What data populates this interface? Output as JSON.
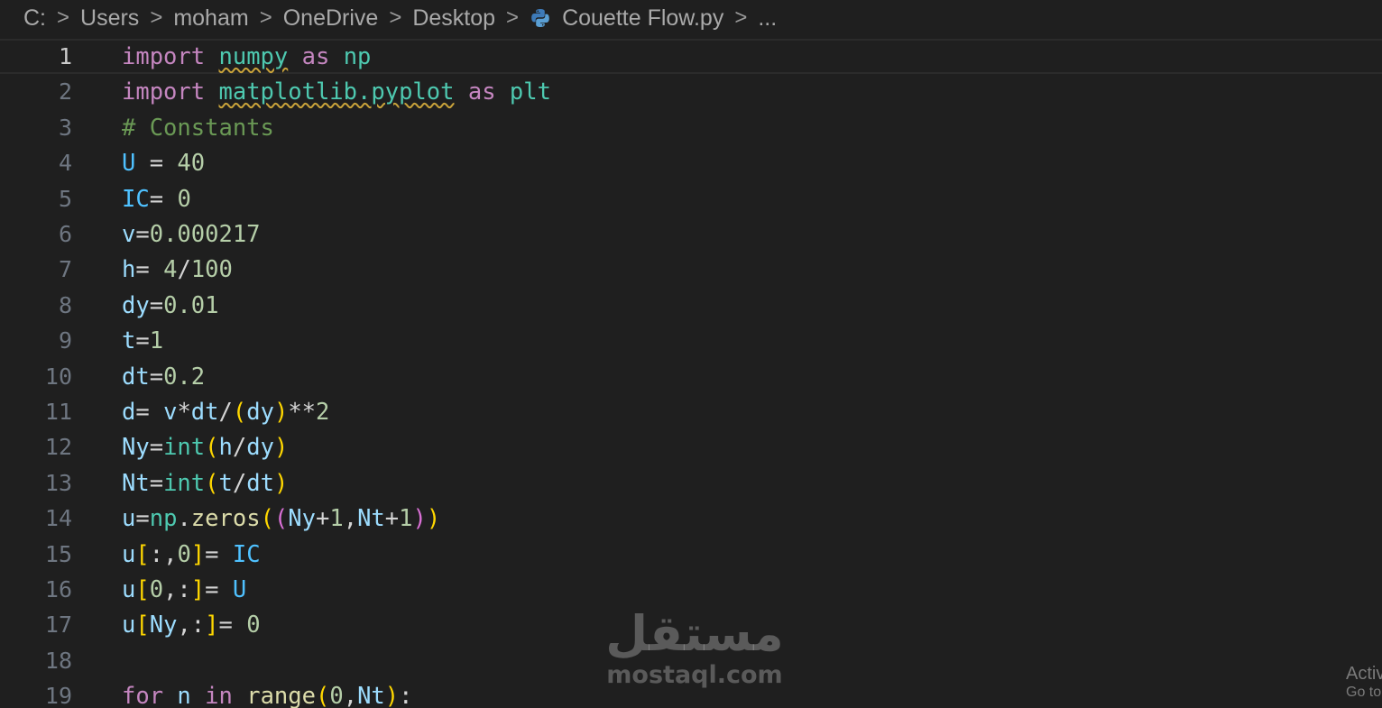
{
  "breadcrumb": {
    "items": [
      "C:",
      "Users",
      "moham",
      "OneDrive",
      "Desktop",
      "Couette Flow.py",
      "..."
    ],
    "separator": ">"
  },
  "editor": {
    "current_line": 1,
    "lines": [
      {
        "n": "1",
        "tokens": [
          [
            "import",
            "kw"
          ],
          [
            " ",
            "op"
          ],
          [
            "numpy",
            "mod squig"
          ],
          [
            " ",
            "op"
          ],
          [
            "as",
            "kw"
          ],
          [
            " ",
            "op"
          ],
          [
            "np",
            "mod"
          ]
        ]
      },
      {
        "n": "2",
        "tokens": [
          [
            "import",
            "kw"
          ],
          [
            " ",
            "op"
          ],
          [
            "matplotlib.pyplot",
            "mod squig"
          ],
          [
            " ",
            "op"
          ],
          [
            "as",
            "kw"
          ],
          [
            " ",
            "op"
          ],
          [
            "plt",
            "mod"
          ]
        ]
      },
      {
        "n": "3",
        "tokens": [
          [
            "# Constants",
            "cmt"
          ]
        ]
      },
      {
        "n": "4",
        "tokens": [
          [
            "U",
            "cst"
          ],
          [
            " = ",
            "op"
          ],
          [
            "40",
            "num"
          ]
        ]
      },
      {
        "n": "5",
        "tokens": [
          [
            "IC",
            "cst"
          ],
          [
            "= ",
            "op"
          ],
          [
            "0",
            "num"
          ]
        ]
      },
      {
        "n": "6",
        "tokens": [
          [
            "v",
            "var"
          ],
          [
            "=",
            "op"
          ],
          [
            "0.000217",
            "num"
          ]
        ]
      },
      {
        "n": "7",
        "tokens": [
          [
            "h",
            "var"
          ],
          [
            "= ",
            "op"
          ],
          [
            "4",
            "num"
          ],
          [
            "/",
            "op"
          ],
          [
            "100",
            "num"
          ]
        ]
      },
      {
        "n": "8",
        "tokens": [
          [
            "dy",
            "var"
          ],
          [
            "=",
            "op"
          ],
          [
            "0.01",
            "num"
          ]
        ]
      },
      {
        "n": "9",
        "tokens": [
          [
            "t",
            "var"
          ],
          [
            "=",
            "op"
          ],
          [
            "1",
            "num"
          ]
        ]
      },
      {
        "n": "10",
        "tokens": [
          [
            "dt",
            "var"
          ],
          [
            "=",
            "op"
          ],
          [
            "0.2",
            "num"
          ]
        ]
      },
      {
        "n": "11",
        "tokens": [
          [
            "d",
            "var"
          ],
          [
            "= ",
            "op"
          ],
          [
            "v",
            "var"
          ],
          [
            "*",
            "op"
          ],
          [
            "dt",
            "var"
          ],
          [
            "/",
            "op"
          ],
          [
            "(",
            "p1"
          ],
          [
            "dy",
            "var"
          ],
          [
            ")",
            "p1"
          ],
          [
            "**",
            "op"
          ],
          [
            "2",
            "num"
          ]
        ]
      },
      {
        "n": "12",
        "tokens": [
          [
            "Ny",
            "var"
          ],
          [
            "=",
            "op"
          ],
          [
            "int",
            "mod"
          ],
          [
            "(",
            "p1"
          ],
          [
            "h",
            "var"
          ],
          [
            "/",
            "op"
          ],
          [
            "dy",
            "var"
          ],
          [
            ")",
            "p1"
          ]
        ]
      },
      {
        "n": "13",
        "tokens": [
          [
            "Nt",
            "var"
          ],
          [
            "=",
            "op"
          ],
          [
            "int",
            "mod"
          ],
          [
            "(",
            "p1"
          ],
          [
            "t",
            "var"
          ],
          [
            "/",
            "op"
          ],
          [
            "dt",
            "var"
          ],
          [
            ")",
            "p1"
          ]
        ]
      },
      {
        "n": "14",
        "tokens": [
          [
            "u",
            "var"
          ],
          [
            "=",
            "op"
          ],
          [
            "np",
            "mod"
          ],
          [
            ".",
            "op"
          ],
          [
            "zeros",
            "fn"
          ],
          [
            "(",
            "p1"
          ],
          [
            "(",
            "p2"
          ],
          [
            "Ny",
            "var"
          ],
          [
            "+",
            "op"
          ],
          [
            "1",
            "num"
          ],
          [
            ",",
            "op"
          ],
          [
            "Nt",
            "var"
          ],
          [
            "+",
            "op"
          ],
          [
            "1",
            "num"
          ],
          [
            ")",
            "p2"
          ],
          [
            ")",
            "p1"
          ]
        ]
      },
      {
        "n": "15",
        "tokens": [
          [
            "u",
            "var"
          ],
          [
            "[",
            "p1"
          ],
          [
            ":,",
            "op"
          ],
          [
            "0",
            "num"
          ],
          [
            "]",
            "p1"
          ],
          [
            "= ",
            "op"
          ],
          [
            "IC",
            "cst"
          ]
        ]
      },
      {
        "n": "16",
        "tokens": [
          [
            "u",
            "var"
          ],
          [
            "[",
            "p1"
          ],
          [
            "0",
            "num"
          ],
          [
            ",:",
            "op"
          ],
          [
            "]",
            "p1"
          ],
          [
            "= ",
            "op"
          ],
          [
            "U",
            "cst"
          ]
        ]
      },
      {
        "n": "17",
        "tokens": [
          [
            "u",
            "var"
          ],
          [
            "[",
            "p1"
          ],
          [
            "Ny",
            "var"
          ],
          [
            ",:",
            "op"
          ],
          [
            "]",
            "p1"
          ],
          [
            "= ",
            "op"
          ],
          [
            "0",
            "num"
          ]
        ]
      },
      {
        "n": "18",
        "tokens": []
      },
      {
        "n": "19",
        "tokens": [
          [
            "for",
            "kw"
          ],
          [
            " ",
            "op"
          ],
          [
            "n",
            "var"
          ],
          [
            " ",
            "op"
          ],
          [
            "in",
            "kw"
          ],
          [
            " ",
            "op"
          ],
          [
            "range",
            "fn"
          ],
          [
            "(",
            "p1"
          ],
          [
            "0",
            "num"
          ],
          [
            ",",
            "op"
          ],
          [
            "Nt",
            "var"
          ],
          [
            ")",
            "p1"
          ],
          [
            ":",
            "op"
          ]
        ]
      }
    ]
  },
  "watermark": {
    "logo": "مستقل",
    "text": "mostaql.com"
  },
  "activation": {
    "line1": "Activate Windows",
    "line2": "Go to Settings to activate Windows."
  },
  "colors": {
    "background": "#1f1f1f",
    "keyword": "#c586c0",
    "module": "#4ec9b0",
    "variable": "#9cdcfe",
    "number": "#b5cea8",
    "comment": "#6a9955"
  }
}
